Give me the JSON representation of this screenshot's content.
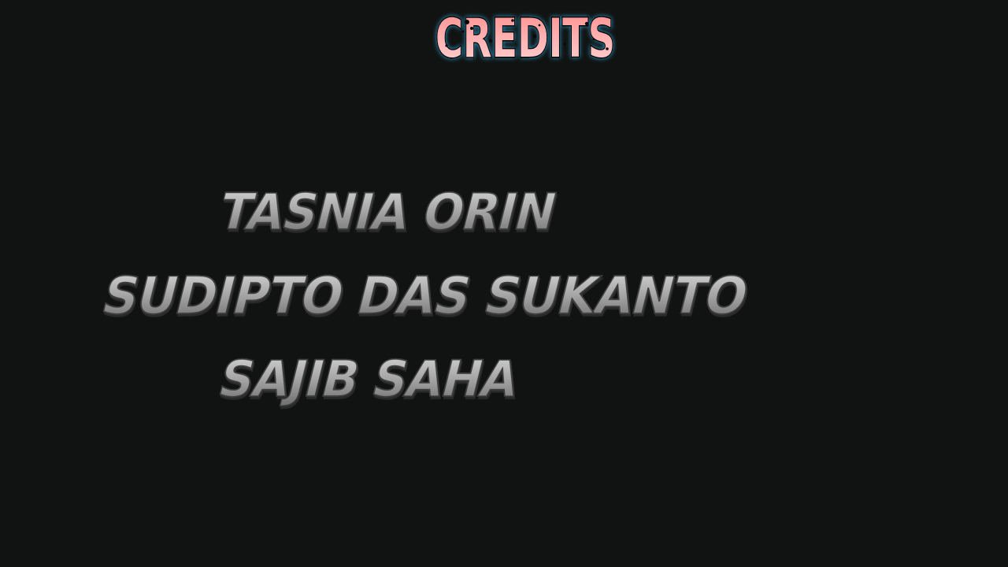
{
  "credits": {
    "title": "CREDITS",
    "names": [
      "TASNIA ORIN",
      "SUDIPTO DAS SUKANTO",
      "SAJIB SAHA"
    ]
  },
  "colors": {
    "background": "#111312",
    "title_fill_top": "#ff8f8f",
    "title_fill_bottom": "#ffd2d2",
    "title_glow": "#2ea7d8",
    "name_fill_top": "#d4d4d4",
    "name_fill_bottom": "#6f6f6f"
  }
}
